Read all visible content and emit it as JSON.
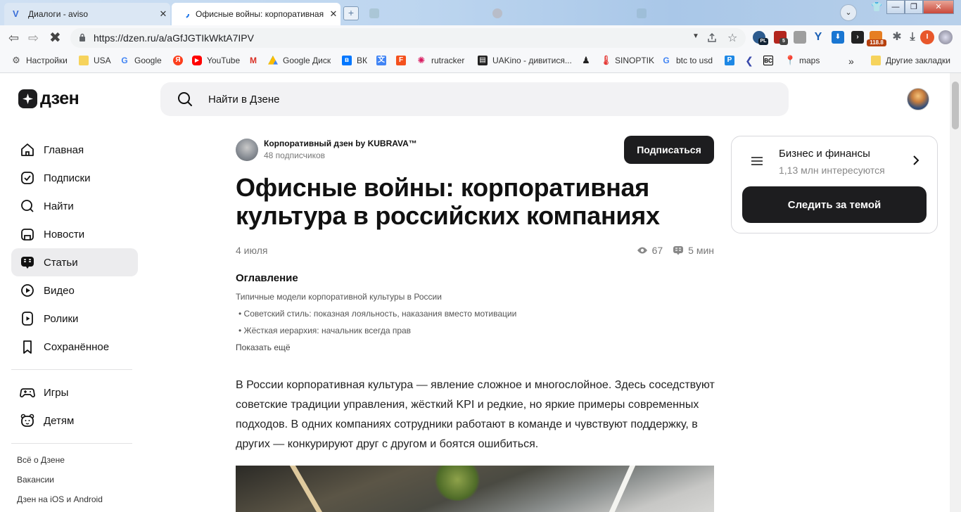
{
  "browser": {
    "tabs": [
      {
        "title": "Диалоги - aviso",
        "close": "✕"
      },
      {
        "title": "Офисные войны: корпоративная",
        "close": "✕"
      }
    ],
    "new_tab": "+",
    "url": "https://dzen.ru/a/aGfJGTIkWktA7IPV",
    "window_controls": {
      "minimize": "—",
      "maximize": "❐",
      "close": "✕"
    },
    "profile_initial": "I",
    "badges": {
      "pl": "PL",
      "num5": "5",
      "speed": "118.8"
    }
  },
  "bookmarks": [
    {
      "label": "Настройки"
    },
    {
      "label": "USA"
    },
    {
      "label": "Google"
    },
    {
      "label": "Яндекс"
    },
    {
      "label": "YouTube"
    },
    {
      "label": "Gmail"
    },
    {
      "label": "Google Диск"
    },
    {
      "label": "ВК"
    },
    {
      "label": "Переводчик"
    },
    {
      "label": "F"
    },
    {
      "label": "rutracker"
    },
    {
      "label": "UAKino - дивитися..."
    },
    {
      "label": "Chess"
    },
    {
      "label": "SINOPTIK"
    },
    {
      "label": "btc to usd"
    },
    {
      "label": "P"
    },
    {
      "label": "<"
    },
    {
      "label": "BC"
    },
    {
      "label": "maps"
    },
    {
      "label": "Другие закладки"
    }
  ],
  "bookmark_overflow": "»",
  "dzen": {
    "logo_text": "дзен",
    "search_placeholder": "Найти в Дзене",
    "nav": [
      {
        "label": "Главная",
        "icon": "home-icon"
      },
      {
        "label": "Подписки",
        "icon": "subscriptions-icon"
      },
      {
        "label": "Найти",
        "icon": "search-icon"
      },
      {
        "label": "Новости",
        "icon": "news-icon"
      },
      {
        "label": "Статьи",
        "icon": "articles-icon",
        "active": true
      },
      {
        "label": "Видео",
        "icon": "video-icon"
      },
      {
        "label": "Ролики",
        "icon": "shorts-icon"
      },
      {
        "label": "Сохранённое",
        "icon": "bookmark-icon"
      }
    ],
    "nav2": [
      {
        "label": "Игры",
        "icon": "gamepad-icon"
      },
      {
        "label": "Детям",
        "icon": "kids-icon"
      }
    ],
    "footer_links": [
      "Всё о Дзене",
      "Вакансии",
      "Дзен на iOS и Android"
    ]
  },
  "article": {
    "channel_name": "Корпоративный дзен by KUBRAVA™",
    "channel_subs": "48 подписчиков",
    "subscribe_label": "Подписаться",
    "title": "Офисные войны: корпоративная культура в российских компаниях",
    "date": "4 июля",
    "views": "67",
    "read_time": "5 мин",
    "toc_heading": "Оглавление",
    "toc": [
      "Типичные модели корпоративной культуры в России",
      "• Советский стиль: показная лояльность, наказания вместо мотивации",
      "• Жёсткая иерархия: начальник всегда прав"
    ],
    "toc_more": "Показать ещё",
    "body": "В России корпоративная культура — явление сложное и многослойное. Здесь соседствуют советские традиции управления, жёсткий KPI и редкие, но яркие примеры современных подходов. В одних компаниях сотрудники работают в команде и чувствуют поддержку, в других — конкурируют друг с другом и боятся ошибиться."
  },
  "topic": {
    "name": "Бизнес и финансы",
    "count": "1,13 млн интересуются",
    "follow_label": "Следить за темой"
  }
}
